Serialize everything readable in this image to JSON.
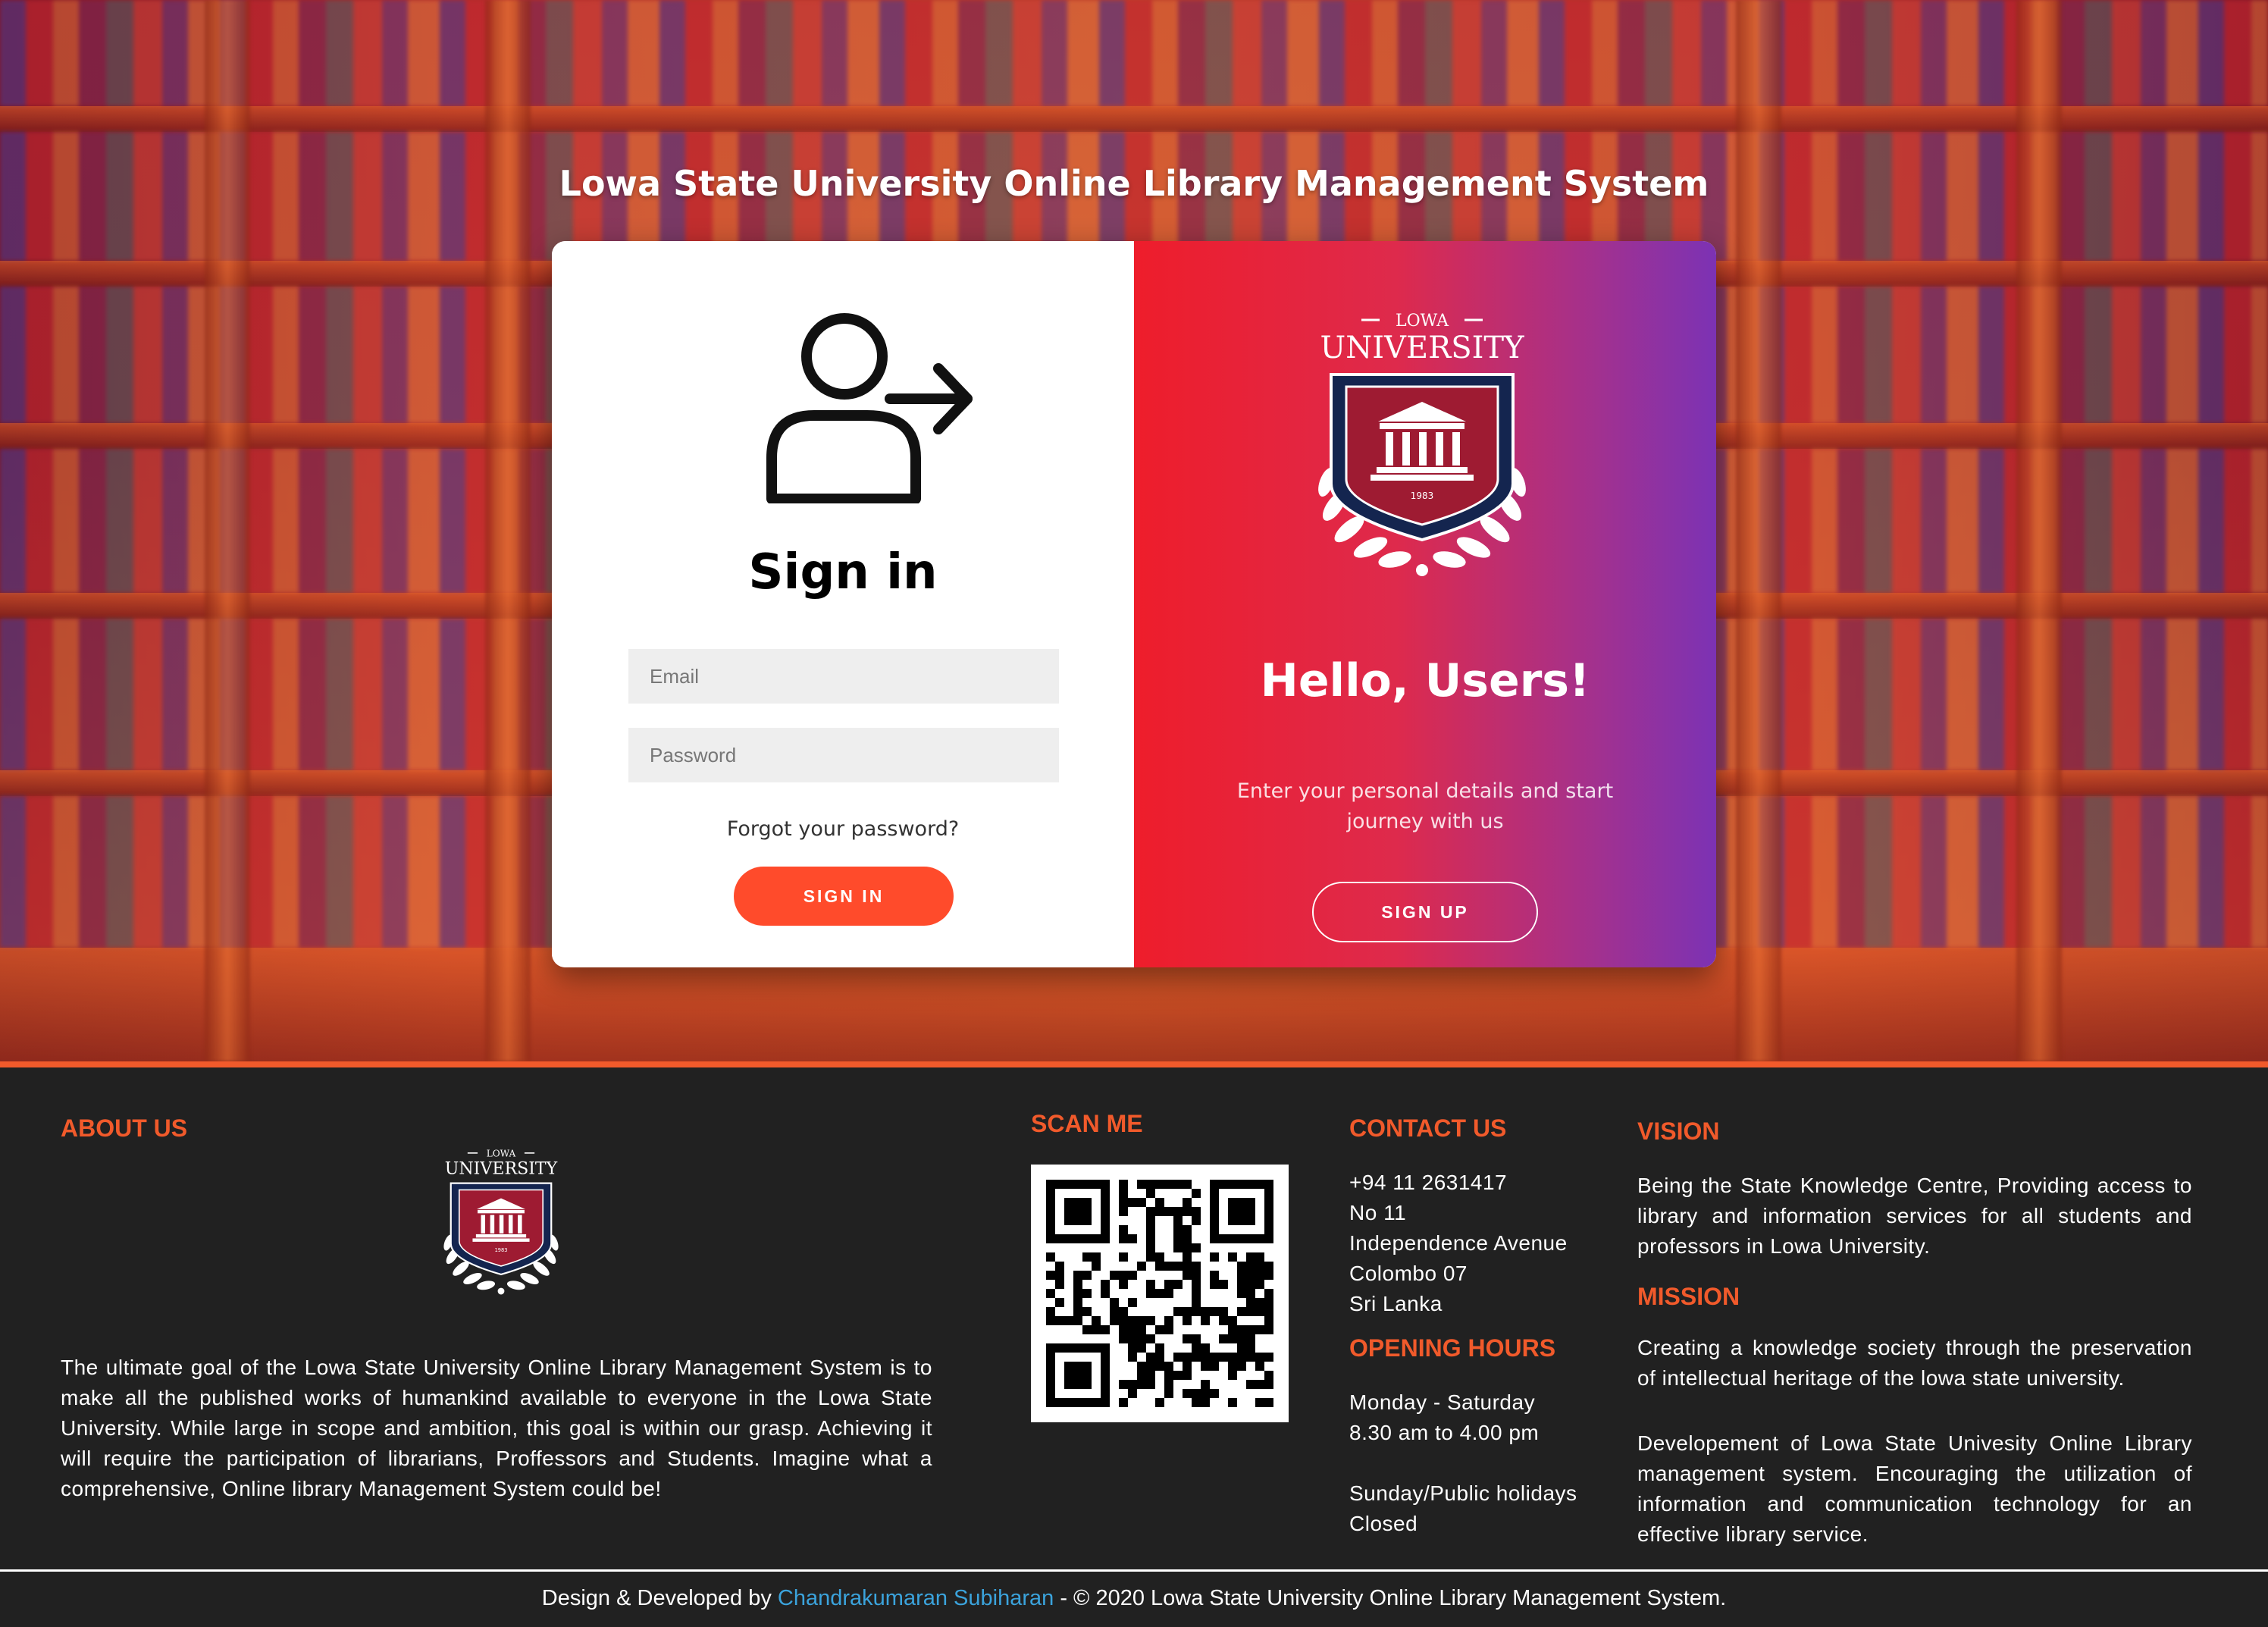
{
  "hero": {
    "title": "Lowa State University Online Library Management System"
  },
  "signin": {
    "heading": "Sign in",
    "email_placeholder": "Email",
    "password_placeholder": "Password",
    "forgot_label": "Forgot your password?",
    "button_label": "SIGN IN",
    "icon": "user-sign-in-icon"
  },
  "welcome": {
    "crest": {
      "top_text": "LOWA",
      "name": "UNIVERSITY",
      "year": "1983"
    },
    "heading": "Hello, Users!",
    "text": "Enter your personal details and start journey with us",
    "button_label": "SIGN UP"
  },
  "footer": {
    "about": {
      "heading": "ABOUT US",
      "text": "The ultimate goal of the Lowa State University Online Library Management System is to make all the published works of humankind available to everyone in the Lowa State University. While large in scope and ambition, this goal is within our grasp. Achieving it will require the participation of librarians, Proffessors and Students. Imagine what a comprehensive, Online library Management System could be!"
    },
    "scan": {
      "heading": "SCAN ME",
      "icon": "qr-code-icon"
    },
    "contact": {
      "heading": "CONTACT US",
      "lines": [
        "+94 11 2631417",
        "No 11",
        "Independence Avenue",
        "Colombo 07",
        "Sri Lanka"
      ]
    },
    "hours": {
      "heading": "OPENING HOURS",
      "weekday_days": "Monday - Saturday",
      "weekday_time": "8.30 am to 4.00 pm",
      "weekend_days": "Sunday/Public holidays",
      "weekend_status": "Closed"
    },
    "vision": {
      "heading": "VISION",
      "text": "Being the State Knowledge Centre, Providing access to library and information services for all students and professors in Lowa University."
    },
    "mission": {
      "heading": "MISSION",
      "text_1": "Creating a knowledge society through the preservation of intellectual heritage of the lowa state university.",
      "text_2": "Developement of Lowa State Univesity Online Library management system. Encouraging the utilization of information and communication technology for an effective library service."
    },
    "credits": {
      "prefix": "Design & Developed by ",
      "developer": "Chandrakumaran Subiharan",
      "suffix": " - © 2020 Lowa State University Online Library Management System."
    }
  },
  "colors": {
    "accent": "#f15a2b",
    "signin_button": "#ff4b2b",
    "gradient_start": "#ee1d2b",
    "gradient_end": "#7c32b4",
    "footer_bg": "#212121",
    "crest_red": "#9e1b32",
    "crest_navy": "#14254f",
    "link": "#3ba3dc"
  }
}
